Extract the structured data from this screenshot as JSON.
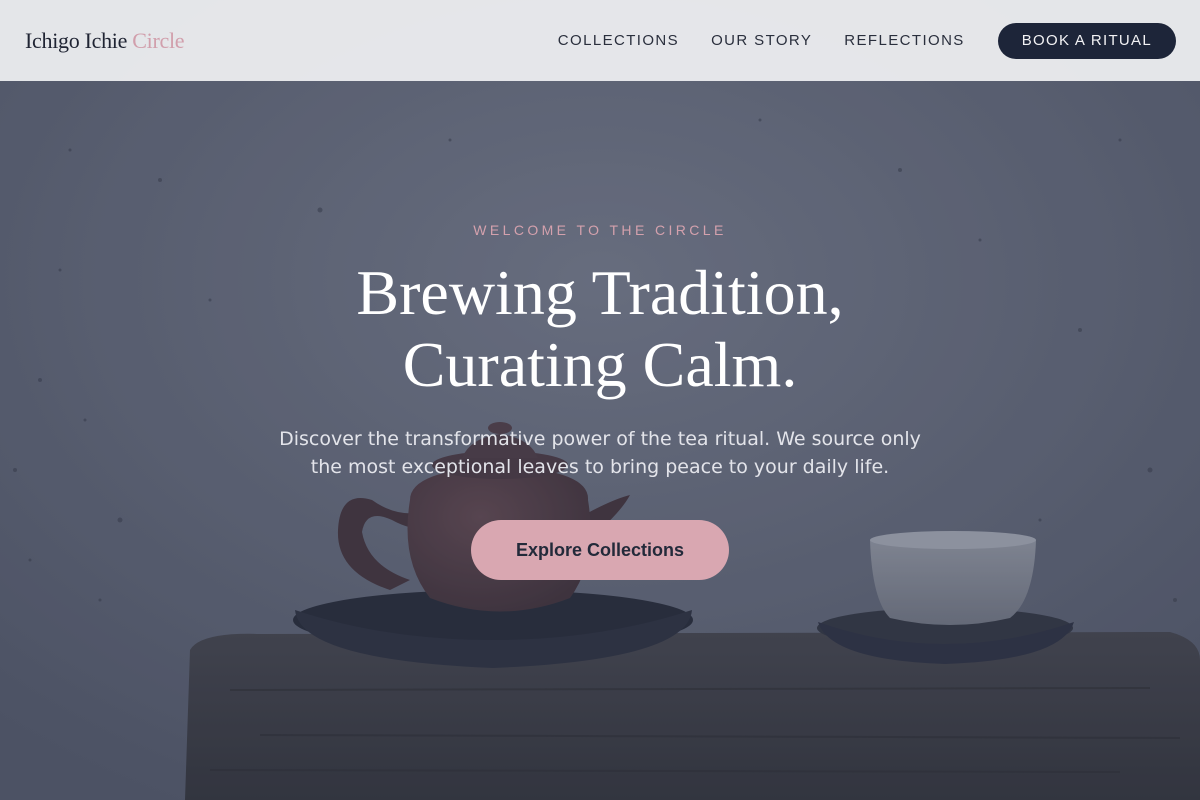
{
  "brand": {
    "name_main": "Ichigo Ichie ",
    "name_accent": "Circle"
  },
  "nav": {
    "items": [
      {
        "label": "COLLECTIONS"
      },
      {
        "label": "OUR STORY"
      },
      {
        "label": "REFLECTIONS"
      }
    ],
    "cta_label": "BOOK A RITUAL"
  },
  "hero": {
    "eyebrow": "WELCOME TO THE CIRCLE",
    "title_line1": "Brewing Tradition,",
    "title_line2": "Curating Calm.",
    "subtitle_line1": "Discover the transformative power of the tea ritual. We source only",
    "subtitle_line2": "the most exceptional leaves to bring peace to your daily life.",
    "cta_label": "Explore Collections"
  },
  "colors": {
    "header_bg": "#e9eaed",
    "brand_accent": "#d19fac",
    "nav_button_bg": "#1d2539",
    "hero_overlay": "#4f5568",
    "cta_bg": "#d9a7b1"
  }
}
